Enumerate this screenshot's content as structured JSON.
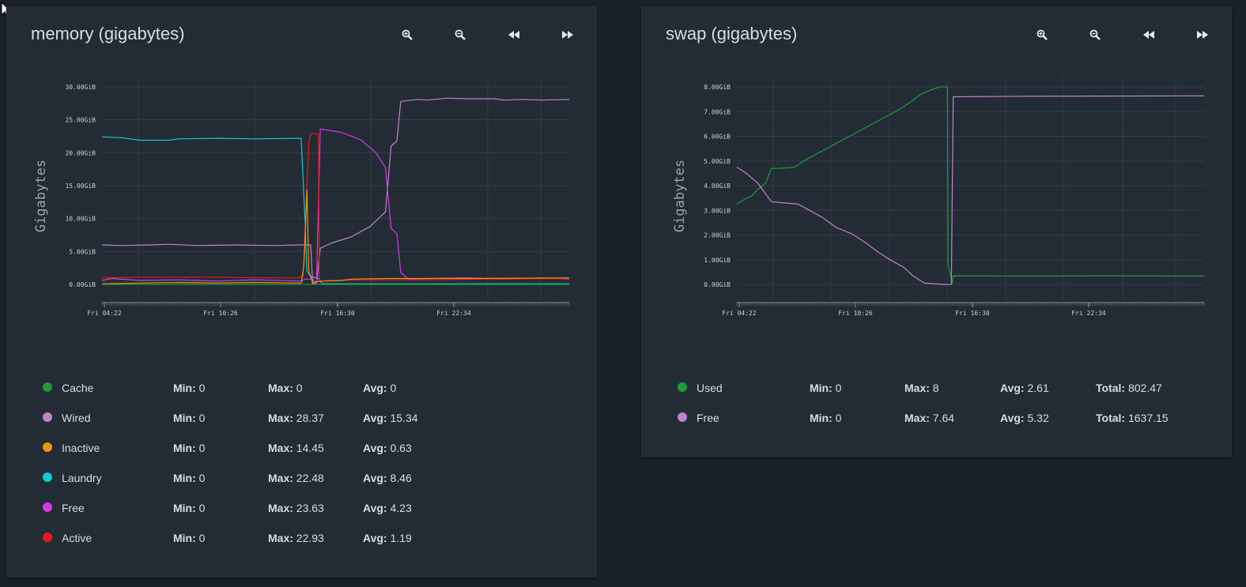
{
  "toolbar": {
    "zoom_in": "zoom-in-icon",
    "zoom_out": "zoom-out-icon",
    "back": "rewind-icon",
    "forward": "fast-forward-icon"
  },
  "panels": [
    {
      "id": "mem",
      "title": "memory (gigabytes)",
      "ylabel": "Gigabytes",
      "yticks": [
        "0.00GiB",
        "5.00GiB",
        "10.00GiB",
        "15.00GiB",
        "20.00GiB",
        "25.00GiB",
        "30.00GiB"
      ],
      "xticks": [
        "Fri 04:22",
        "Fri 10:26",
        "Fri 16:30",
        "Fri 22:34"
      ],
      "legend": [
        {
          "name": "Cache",
          "color": "#1f9a3a",
          "min": "0",
          "max": "0",
          "avg": "0"
        },
        {
          "name": "Wired",
          "color": "#c083c9",
          "min": "0",
          "max": "28.37",
          "avg": "15.34"
        },
        {
          "name": "Inactive",
          "color": "#f0950a",
          "min": "0",
          "max": "14.45",
          "avg": "0.63"
        },
        {
          "name": "Laundry",
          "color": "#14c9d2",
          "min": "0",
          "max": "22.48",
          "avg": "8.46"
        },
        {
          "name": "Free",
          "color": "#d63ae6",
          "min": "0",
          "max": "23.63",
          "avg": "4.23"
        },
        {
          "name": "Active",
          "color": "#f0141e",
          "min": "0",
          "max": "22.93",
          "avg": "1.19"
        }
      ]
    },
    {
      "id": "swap",
      "title": "swap (gigabytes)",
      "ylabel": "Gigabytes",
      "yticks": [
        "0.00GiB",
        "1.00GiB",
        "2.00GiB",
        "3.00GiB",
        "4.00GiB",
        "5.00GiB",
        "6.00GiB",
        "7.00GiB",
        "8.00GiB"
      ],
      "xticks": [
        "Fri 04:22",
        "Fri 10:26",
        "Fri 16:30",
        "Fri 22:34"
      ],
      "legend": [
        {
          "name": "Used",
          "color": "#1f9a3a",
          "min": "0",
          "max": "8",
          "avg": "2.61",
          "total": "802.47"
        },
        {
          "name": "Free",
          "color": "#c083c9",
          "min": "0",
          "max": "7.64",
          "avg": "5.32",
          "total": "1637.15"
        }
      ]
    }
  ],
  "labels": {
    "min": "Min:",
    "max": "Max:",
    "avg": "Avg:",
    "total": "Total:"
  },
  "chart_data": [
    {
      "type": "line",
      "title": "memory (gigabytes)",
      "ylabel": "Gigabytes",
      "xlabel": "",
      "x_range_hours": [
        3.0,
        27.4
      ],
      "ylim": [
        0,
        30
      ],
      "series": [
        {
          "name": "Laundry",
          "points": [
            [
              3.0,
              22.4
            ],
            [
              4.0,
              22.3
            ],
            [
              5.0,
              21.9
            ],
            [
              6.5,
              21.9
            ],
            [
              7.0,
              22.1
            ],
            [
              9.0,
              22.2
            ],
            [
              11.0,
              22.1
            ],
            [
              13.3,
              22.2
            ],
            [
              13.4,
              22.2
            ],
            [
              13.6,
              10
            ],
            [
              13.7,
              2
            ],
            [
              13.9,
              1.2
            ],
            [
              14.3,
              0.9
            ],
            [
              14.5,
              0.1
            ],
            [
              27.4,
              0.1
            ]
          ]
        },
        {
          "name": "Wired",
          "points": [
            [
              3.0,
              6.0
            ],
            [
              4.0,
              5.9
            ],
            [
              5.5,
              6.0
            ],
            [
              6.5,
              6.1
            ],
            [
              8.0,
              5.9
            ],
            [
              10.0,
              6.0
            ],
            [
              12.0,
              5.9
            ],
            [
              13.3,
              6.0
            ],
            [
              13.9,
              6.0
            ],
            [
              14.0,
              0.1
            ],
            [
              14.2,
              0.2
            ],
            [
              14.4,
              5.5
            ],
            [
              15.0,
              6.3
            ],
            [
              16.0,
              7.2
            ],
            [
              17.0,
              8.8
            ],
            [
              17.8,
              11.0
            ],
            [
              18.1,
              21.0
            ],
            [
              18.4,
              21.8
            ],
            [
              18.6,
              27.8
            ],
            [
              19.5,
              28.1
            ],
            [
              20.0,
              28.0
            ],
            [
              21.0,
              28.3
            ],
            [
              22.0,
              28.2
            ],
            [
              23.5,
              28.2
            ],
            [
              24.0,
              28.0
            ],
            [
              25.0,
              28.1
            ],
            [
              26.0,
              28.0
            ],
            [
              27.4,
              28.1
            ]
          ]
        },
        {
          "name": "Free",
          "points": [
            [
              3.0,
              0.6
            ],
            [
              3.5,
              0.9
            ],
            [
              5.0,
              0.6
            ],
            [
              7.0,
              0.7
            ],
            [
              9.0,
              0.5
            ],
            [
              11.0,
              0.7
            ],
            [
              13.4,
              0.5
            ],
            [
              13.6,
              0.8
            ],
            [
              14.0,
              0.8
            ],
            [
              14.2,
              0.1
            ],
            [
              14.4,
              23.6
            ],
            [
              15.5,
              23.1
            ],
            [
              16.5,
              22.0
            ],
            [
              17.3,
              20.0
            ],
            [
              17.8,
              17.8
            ],
            [
              18.1,
              8.5
            ],
            [
              18.4,
              7.7
            ],
            [
              18.6,
              1.8
            ],
            [
              19.0,
              0.8
            ],
            [
              20.0,
              0.9
            ],
            [
              22.0,
              1.0
            ],
            [
              24.0,
              0.8
            ],
            [
              26.0,
              1.0
            ],
            [
              27.4,
              0.8
            ]
          ]
        },
        {
          "name": "Active",
          "points": [
            [
              3.0,
              1.0
            ],
            [
              5.0,
              1.1
            ],
            [
              7.0,
              1.1
            ],
            [
              9.0,
              1.1
            ],
            [
              11.0,
              1.0
            ],
            [
              13.3,
              1.0
            ],
            [
              13.5,
              1.2
            ],
            [
              13.8,
              21.5
            ],
            [
              13.9,
              22.9
            ],
            [
              14.3,
              22.9
            ],
            [
              14.35,
              0.5
            ],
            [
              15.0,
              0.6
            ],
            [
              17.0,
              0.7
            ],
            [
              20.0,
              0.7
            ],
            [
              23.0,
              0.8
            ],
            [
              27.4,
              0.9
            ]
          ]
        },
        {
          "name": "Inactive",
          "points": [
            [
              3.0,
              0.1
            ],
            [
              5.0,
              0.2
            ],
            [
              7.0,
              0.3
            ],
            [
              9.0,
              0.2
            ],
            [
              11.0,
              0.3
            ],
            [
              13.4,
              0.2
            ],
            [
              13.55,
              3.0
            ],
            [
              13.7,
              14.4
            ],
            [
              13.8,
              2.0
            ],
            [
              14.0,
              0.3
            ],
            [
              14.5,
              0.5
            ],
            [
              15.5,
              0.6
            ],
            [
              16.0,
              0.8
            ],
            [
              18.0,
              0.9
            ],
            [
              22.0,
              0.9
            ],
            [
              27.4,
              1.0
            ]
          ]
        },
        {
          "name": "Cache",
          "points": [
            [
              3.0,
              0
            ],
            [
              27.4,
              0
            ]
          ]
        }
      ]
    },
    {
      "type": "line",
      "title": "swap (gigabytes)",
      "ylabel": "Gigabytes",
      "xlabel": "",
      "x_range_hours": [
        3.0,
        27.4
      ],
      "ylim": [
        0,
        8
      ],
      "series": [
        {
          "name": "Used",
          "points": [
            [
              3.0,
              3.25
            ],
            [
              3.4,
              3.45
            ],
            [
              3.8,
              3.6
            ],
            [
              4.1,
              3.85
            ],
            [
              4.5,
              4.1
            ],
            [
              4.8,
              4.7
            ],
            [
              5.2,
              4.7
            ],
            [
              6.0,
              4.75
            ],
            [
              6.6,
              5.05
            ],
            [
              7.2,
              5.3
            ],
            [
              7.8,
              5.55
            ],
            [
              8.4,
              5.8
            ],
            [
              9.0,
              6.05
            ],
            [
              9.6,
              6.3
            ],
            [
              10.2,
              6.55
            ],
            [
              10.8,
              6.8
            ],
            [
              11.4,
              7.05
            ],
            [
              12.0,
              7.35
            ],
            [
              12.6,
              7.7
            ],
            [
              13.2,
              7.9
            ],
            [
              13.6,
              8.0
            ],
            [
              14.0,
              8.0
            ],
            [
              14.03,
              0.8
            ],
            [
              14.25,
              0.05
            ],
            [
              14.3,
              0.35
            ],
            [
              18.0,
              0.34
            ],
            [
              22.0,
              0.35
            ],
            [
              27.4,
              0.34
            ]
          ]
        },
        {
          "name": "Free",
          "points": [
            [
              3.0,
              4.75
            ],
            [
              3.5,
              4.5
            ],
            [
              4.1,
              4.1
            ],
            [
              4.8,
              3.35
            ],
            [
              5.5,
              3.3
            ],
            [
              6.2,
              3.25
            ],
            [
              6.8,
              3.0
            ],
            [
              7.5,
              2.7
            ],
            [
              8.2,
              2.3
            ],
            [
              9.0,
              2.05
            ],
            [
              9.7,
              1.7
            ],
            [
              10.4,
              1.3
            ],
            [
              11.0,
              1.0
            ],
            [
              11.7,
              0.7
            ],
            [
              12.2,
              0.35
            ],
            [
              12.8,
              0.05
            ],
            [
              13.8,
              0.0
            ],
            [
              14.2,
              0.0
            ],
            [
              14.3,
              7.6
            ],
            [
              18.0,
              7.62
            ],
            [
              22.0,
              7.63
            ],
            [
              27.4,
              7.64
            ]
          ]
        }
      ]
    }
  ]
}
